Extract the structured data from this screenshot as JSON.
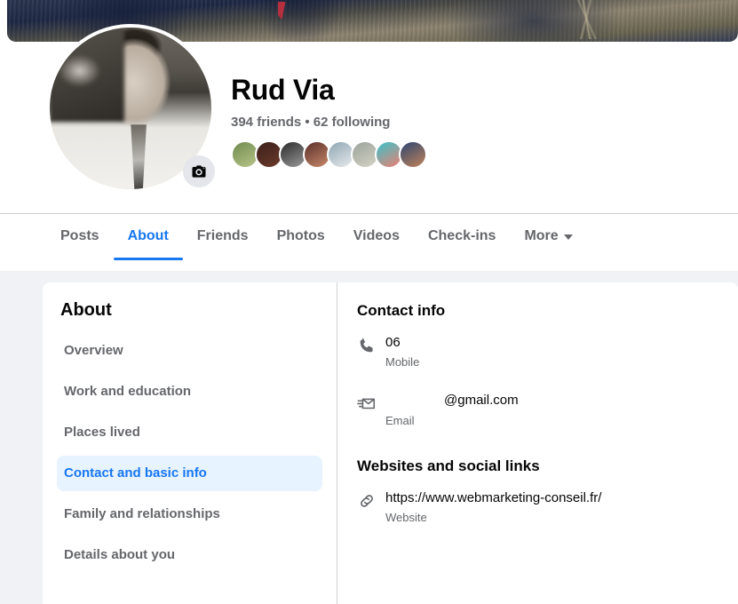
{
  "profile": {
    "name": "Rud Via",
    "stats": "394 friends • 62 following",
    "camera_icon": "camera-icon",
    "cover_photo_alt": "cover-photo",
    "friend_thumbs": [
      {
        "name": "friend-thumb-1",
        "color1": "#6f8a4e",
        "color2": "#b9c68a"
      },
      {
        "name": "friend-thumb-2",
        "color1": "#3a1f1a",
        "color2": "#6d3b2c"
      },
      {
        "name": "friend-thumb-3",
        "color1": "#2b2b2b",
        "color2": "#9a9a9a"
      },
      {
        "name": "friend-thumb-4",
        "color1": "#5a2f2a",
        "color2": "#c98a6a"
      },
      {
        "name": "friend-thumb-5",
        "color1": "#8fa7b3",
        "color2": "#e8eaec"
      },
      {
        "name": "friend-thumb-6",
        "color1": "#9aa39a",
        "color2": "#d6d3c6"
      },
      {
        "name": "friend-thumb-7",
        "color1": "#38c3c9",
        "color2": "#f07d72"
      },
      {
        "name": "friend-thumb-8",
        "color1": "#2c4670",
        "color2": "#c2835a"
      }
    ]
  },
  "tabs": [
    {
      "label": "Posts",
      "name": "tab-posts",
      "active": false,
      "caret": false
    },
    {
      "label": "About",
      "name": "tab-about",
      "active": true,
      "caret": false
    },
    {
      "label": "Friends",
      "name": "tab-friends",
      "active": false,
      "caret": false
    },
    {
      "label": "Photos",
      "name": "tab-photos",
      "active": false,
      "caret": false
    },
    {
      "label": "Videos",
      "name": "tab-videos",
      "active": false,
      "caret": false
    },
    {
      "label": "Check-ins",
      "name": "tab-check-ins",
      "active": false,
      "caret": false
    },
    {
      "label": "More",
      "name": "tab-more",
      "active": false,
      "caret": true
    }
  ],
  "about": {
    "title": "About",
    "nav_items": [
      {
        "label": "Overview",
        "name": "sidebar-item-overview",
        "active": false
      },
      {
        "label": "Work and education",
        "name": "sidebar-item-work-and-education",
        "active": false
      },
      {
        "label": "Places lived",
        "name": "sidebar-item-places-lived",
        "active": false
      },
      {
        "label": "Contact and basic info",
        "name": "sidebar-item-contact-and-basic-info",
        "active": true
      },
      {
        "label": "Family and relationships",
        "name": "sidebar-item-family-and-relationships",
        "active": false
      },
      {
        "label": "Details about you",
        "name": "sidebar-item-details-about-you",
        "active": false
      }
    ],
    "contact_info": {
      "heading": "Contact info",
      "rows": [
        {
          "icon": "phone-icon",
          "value": "06",
          "label": "Mobile",
          "indented": false,
          "row_name": "contact-row-mobile"
        },
        {
          "icon": "email-icon",
          "value": "@gmail.com",
          "label": "Email",
          "indented": true,
          "row_name": "contact-row-email"
        }
      ]
    },
    "websites": {
      "heading": "Websites and social links",
      "rows": [
        {
          "icon": "link-icon",
          "value": "https://www.webmarketing-conseil.fr/",
          "label": "Website",
          "indented": false,
          "row_name": "website-row"
        }
      ]
    }
  },
  "colors": {
    "accent": "#1877f2",
    "accent_pill": "#e7f3ff",
    "page_bg": "#f0f2f5",
    "text_primary": "#050505",
    "text_secondary": "#65676b",
    "icon_gray": "#65676b"
  }
}
